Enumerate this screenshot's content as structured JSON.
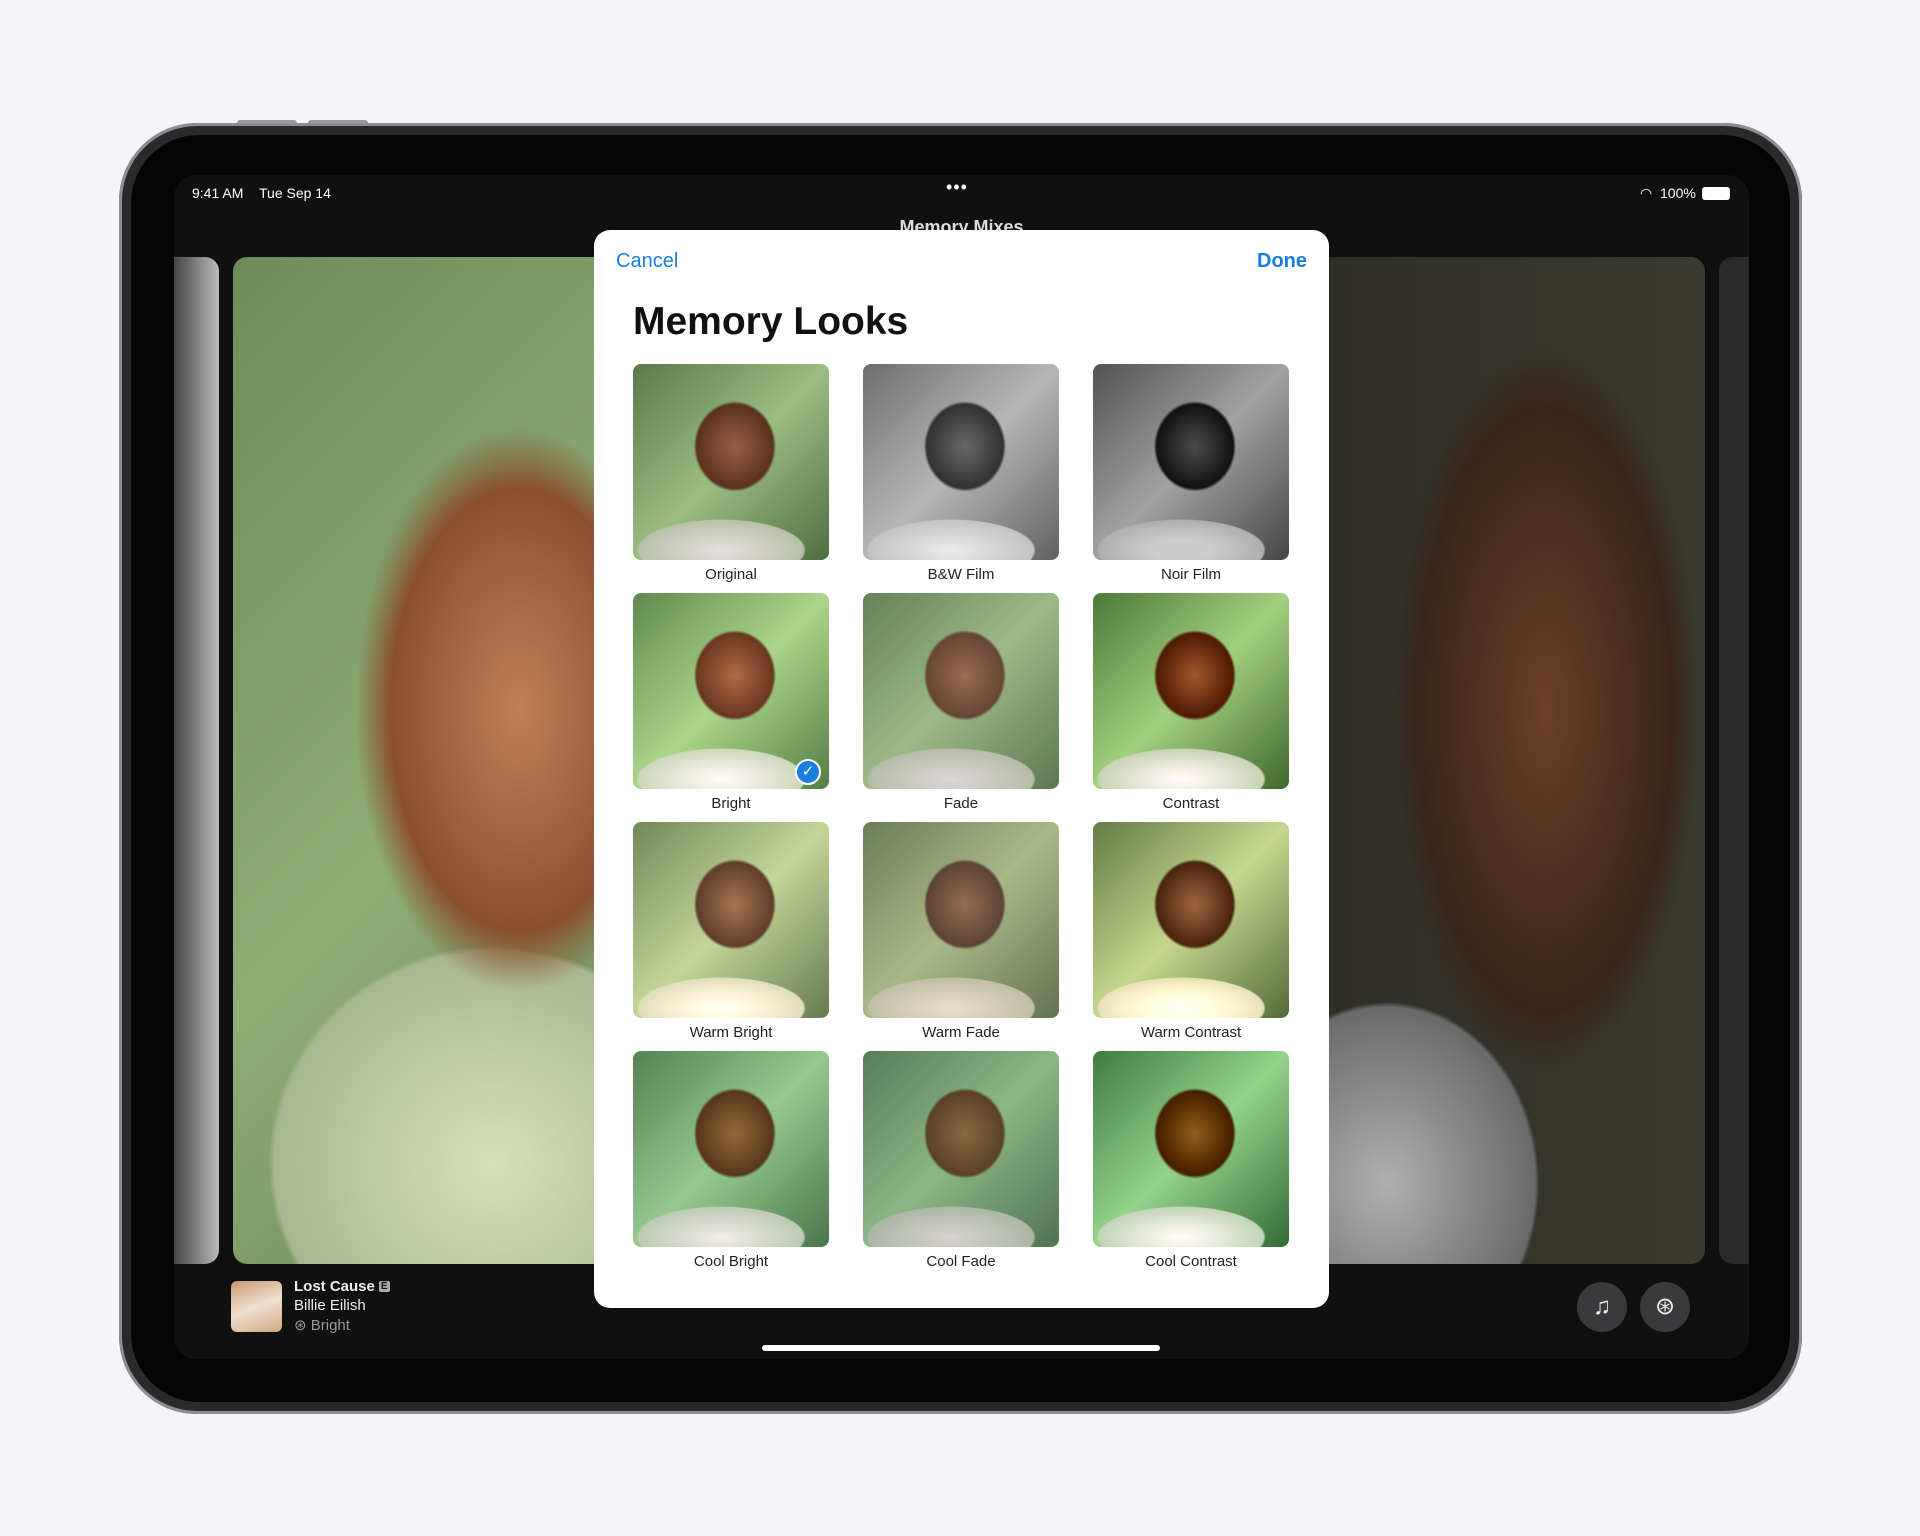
{
  "status_bar": {
    "time": "9:41 AM",
    "date": "Tue Sep 14",
    "battery": "100%",
    "icons": [
      "wifi-icon",
      "battery-icon"
    ]
  },
  "screen_title": "Memory Mixes",
  "modal": {
    "cancel": "Cancel",
    "done": "Done",
    "title": "Memory Looks",
    "looks": [
      {
        "label": "Original"
      },
      {
        "label": "B&W Film"
      },
      {
        "label": "Noir Film"
      },
      {
        "label": "Bright",
        "selected": true
      },
      {
        "label": "Fade"
      },
      {
        "label": "Contrast"
      },
      {
        "label": "Warm Bright"
      },
      {
        "label": "Warm Fade"
      },
      {
        "label": "Warm Contrast"
      },
      {
        "label": "Cool Bright"
      },
      {
        "label": "Cool Fade"
      },
      {
        "label": "Cool Contrast"
      }
    ]
  },
  "now_playing": {
    "song": "Lost Cause",
    "explicit": "E",
    "artist": "Billie Eilish",
    "look": "Bright"
  },
  "controls": {
    "music_icon": "music-note-plus-icon",
    "looks_icon": "memory-looks-icon"
  },
  "colors": {
    "accent": "#1a7ee0"
  }
}
